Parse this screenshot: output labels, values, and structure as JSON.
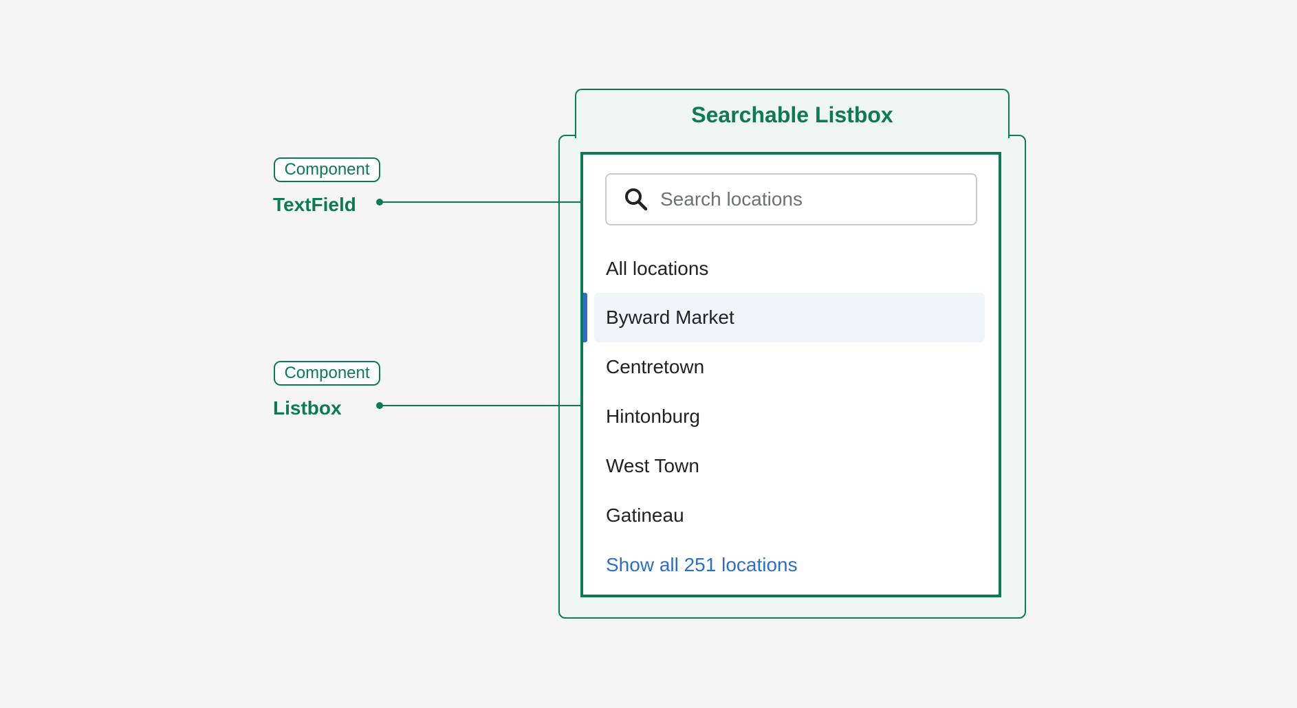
{
  "diagram": {
    "title": "Searchable Listbox",
    "annotations": [
      {
        "badge": "Component",
        "name": "TextField"
      },
      {
        "badge": "Component",
        "name": "Listbox"
      }
    ]
  },
  "search": {
    "placeholder": "Search locations",
    "icon": "search-icon"
  },
  "listbox": {
    "options": [
      {
        "label": "All locations",
        "selected": false
      },
      {
        "label": "Byward Market",
        "selected": true
      },
      {
        "label": "Centretown",
        "selected": false
      },
      {
        "label": "Hintonburg",
        "selected": false
      },
      {
        "label": "West Town",
        "selected": false
      },
      {
        "label": "Gatineau",
        "selected": false
      }
    ],
    "show_all_label": "Show all 251 locations"
  },
  "colors": {
    "accent_green": "#0b7a55",
    "link_blue": "#2c6ecb",
    "selected_background": "#f1f5fb",
    "frame_background": "#eef5f2",
    "page_background": "#f5f5f5"
  }
}
